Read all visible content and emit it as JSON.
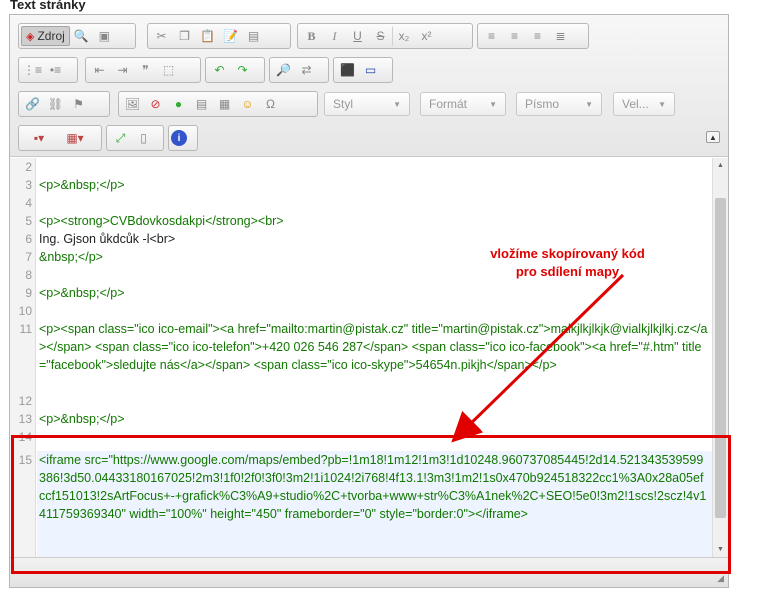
{
  "heading": "Text stránky",
  "toolbar": {
    "source_label": "Zdroj",
    "style_placeholder": "Styl",
    "format_placeholder": "Formát",
    "font_placeholder": "Písmo",
    "size_placeholder": "Vel...",
    "bold": "B",
    "italic": "I",
    "underline": "U",
    "strike": "S",
    "subscript": "x₂",
    "superscript": "x²",
    "omega": "Ω",
    "info": "i"
  },
  "code": {
    "line_numbers": [
      "2",
      "3",
      "4",
      "5",
      "6",
      "7",
      "8",
      "9",
      "10",
      "11",
      "12",
      "13",
      "14",
      "15"
    ],
    "lines": [
      {
        "n": "3",
        "text": "<p>&nbsp;</p>"
      },
      {
        "n": "5",
        "text": "<p><strong>CVBdovkosdakpi</strong><br>"
      },
      {
        "n": "6",
        "text": "Ing. Gjson ůkdcůk -l<br>"
      },
      {
        "n": "7",
        "text": "&nbsp;</p>"
      },
      {
        "n": "9",
        "text": "<p>&nbsp;</p>"
      },
      {
        "n": "11",
        "text": "<p><span class=\"ico ico-email\"><a href=\"mailto:martin@pistak.cz\" title=\"martin@pistak.cz\">malkjlkjlkjk@vialkjlkjlkj.cz</a></span> <span class=\"ico ico-telefon\">+420 026 546 287</span> <span class=\"ico ico-facebook\"><a href=\"#.htm\" title=\"facebook\">sledujte nás</a></span> <span class=\"ico ico-skype\">54654n.pikjh</span></p>"
      },
      {
        "n": "13",
        "text": "<p>&nbsp;</p>"
      },
      {
        "n": "15",
        "text": "<iframe src=\"https://www.google.com/maps/embed?pb=!1m18!1m12!1m3!1d10248.960737085445!2d14.521343539599386!3d50.04433180167025!2m3!1f0!2f0!3f0!3m2!1i1024!2i768!4f13.1!3m3!1m2!1s0x470b924518322cc1%3A0x28a05efccf151013!2sArtFocus+-+grafick%C3%A9+studio%2C+tvorba+www+str%C3%A1nek%2C+SEO!5e0!3m2!1scs!2scz!4v1411759369340\" width=\"100%\" height=\"450\" frameborder=\"0\" style=\"border:0\"></iframe>"
      }
    ]
  },
  "annotation": {
    "line1": "vložíme skopírovaný kód",
    "line2": "pro sdílení mapy",
    "color": "#e00000"
  }
}
